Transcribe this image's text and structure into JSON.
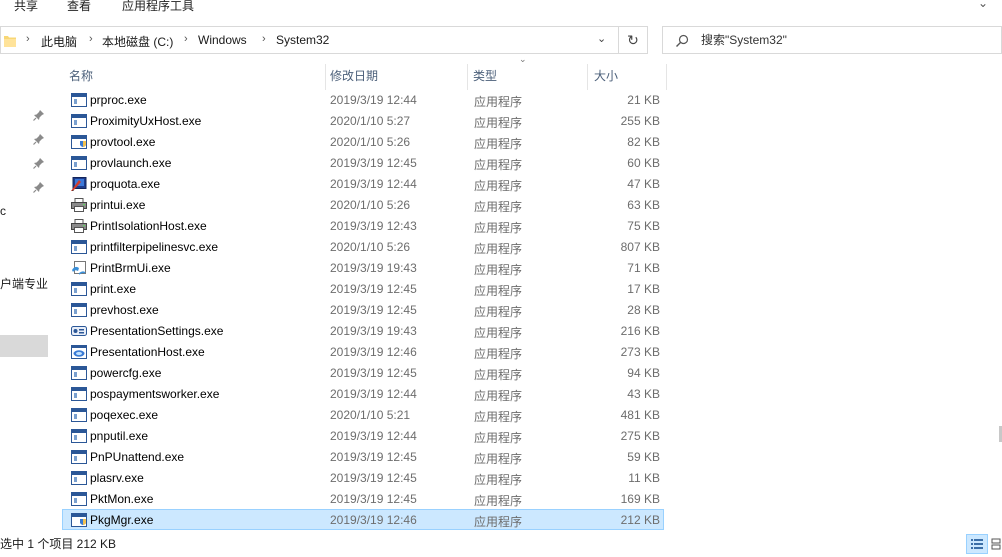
{
  "ribbon": {
    "tabs": [
      {
        "label": "共享"
      },
      {
        "label": "查看"
      },
      {
        "label": "应用程序工具"
      }
    ]
  },
  "address": {
    "breadcrumbs": [
      "此电脑",
      "本地磁盘 (C:)",
      "Windows",
      "System32"
    ]
  },
  "search": {
    "placeholder": "搜索\"System32\""
  },
  "nav": {
    "fragments": [
      "c",
      "户端专业"
    ]
  },
  "columns": {
    "name": "名称",
    "date": "修改日期",
    "type": "类型",
    "size": "大小"
  },
  "files": [
    {
      "name": "prproc.exe",
      "date": "2019/3/19 12:44",
      "type": "应用程序",
      "size": "21 KB",
      "icon": "exe-window-icon"
    },
    {
      "name": "ProximityUxHost.exe",
      "date": "2020/1/10 5:27",
      "type": "应用程序",
      "size": "255 KB",
      "icon": "exe-window-icon"
    },
    {
      "name": "provtool.exe",
      "date": "2020/1/10 5:26",
      "type": "应用程序",
      "size": "82 KB",
      "icon": "exe-shield-icon"
    },
    {
      "name": "provlaunch.exe",
      "date": "2019/3/19 12:45",
      "type": "应用程序",
      "size": "60 KB",
      "icon": "exe-window-icon"
    },
    {
      "name": "proquota.exe",
      "date": "2019/3/19 12:44",
      "type": "应用程序",
      "size": "47 KB",
      "icon": "proquota-icon"
    },
    {
      "name": "printui.exe",
      "date": "2020/1/10 5:26",
      "type": "应用程序",
      "size": "63 KB",
      "icon": "printer-icon"
    },
    {
      "name": "PrintIsolationHost.exe",
      "date": "2019/3/19 12:43",
      "type": "应用程序",
      "size": "75 KB",
      "icon": "printer-icon"
    },
    {
      "name": "printfilterpipelinesvc.exe",
      "date": "2020/1/10 5:26",
      "type": "应用程序",
      "size": "807 KB",
      "icon": "exe-window-icon"
    },
    {
      "name": "PrintBrmUi.exe",
      "date": "2019/3/19 19:43",
      "type": "应用程序",
      "size": "71 KB",
      "icon": "printbrm-icon"
    },
    {
      "name": "print.exe",
      "date": "2019/3/19 12:45",
      "type": "应用程序",
      "size": "17 KB",
      "icon": "exe-window-icon"
    },
    {
      "name": "prevhost.exe",
      "date": "2019/3/19 12:45",
      "type": "应用程序",
      "size": "28 KB",
      "icon": "exe-window-icon"
    },
    {
      "name": "PresentationSettings.exe",
      "date": "2019/3/19 19:43",
      "type": "应用程序",
      "size": "216 KB",
      "icon": "presentation-settings-icon"
    },
    {
      "name": "PresentationHost.exe",
      "date": "2019/3/19 12:46",
      "type": "应用程序",
      "size": "273 KB",
      "icon": "presentation-host-icon"
    },
    {
      "name": "powercfg.exe",
      "date": "2019/3/19 12:45",
      "type": "应用程序",
      "size": "94 KB",
      "icon": "exe-window-icon"
    },
    {
      "name": "pospaymentsworker.exe",
      "date": "2019/3/19 12:44",
      "type": "应用程序",
      "size": "43 KB",
      "icon": "exe-window-icon"
    },
    {
      "name": "poqexec.exe",
      "date": "2020/1/10 5:21",
      "type": "应用程序",
      "size": "481 KB",
      "icon": "exe-window-icon"
    },
    {
      "name": "pnputil.exe",
      "date": "2019/3/19 12:44",
      "type": "应用程序",
      "size": "275 KB",
      "icon": "exe-window-icon"
    },
    {
      "name": "PnPUnattend.exe",
      "date": "2019/3/19 12:45",
      "type": "应用程序",
      "size": "59 KB",
      "icon": "exe-window-icon"
    },
    {
      "name": "plasrv.exe",
      "date": "2019/3/19 12:45",
      "type": "应用程序",
      "size": "11 KB",
      "icon": "exe-window-icon"
    },
    {
      "name": "PktMon.exe",
      "date": "2019/3/19 12:45",
      "type": "应用程序",
      "size": "169 KB",
      "icon": "exe-window-icon"
    },
    {
      "name": "PkgMgr.exe",
      "date": "2019/3/19 12:46",
      "type": "应用程序",
      "size": "212 KB",
      "icon": "exe-shield-icon",
      "selected": true
    }
  ],
  "status": {
    "text": "选中 1 个项目  212 KB"
  },
  "colors": {
    "selection_bg": "#cce8ff",
    "selection_border": "#99d1ff",
    "header_text": "#4c607a",
    "secondary_text": "#6d6d6d"
  }
}
